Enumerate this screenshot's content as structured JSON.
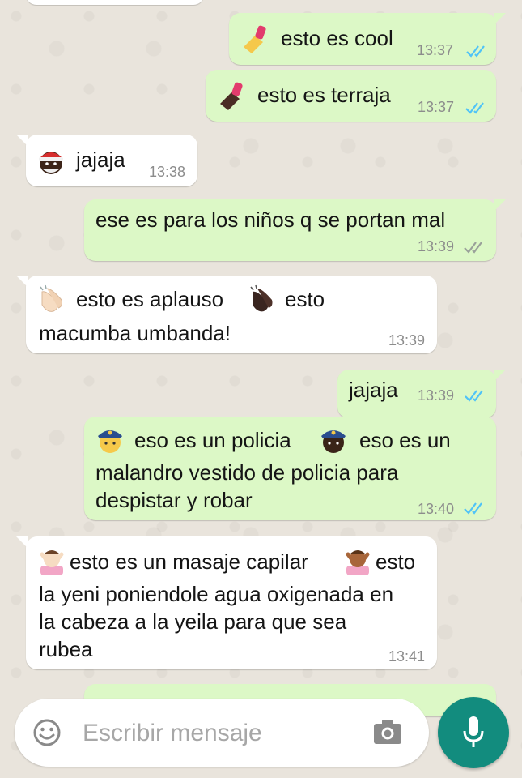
{
  "messages": [
    {
      "direction": "outgoing",
      "emojis": [
        "nail-polish-light"
      ],
      "text": "esto es cool",
      "time": "13:37",
      "status": "read"
    },
    {
      "direction": "outgoing",
      "emojis": [
        "nail-polish-dark"
      ],
      "text": "esto es terraja",
      "time": "13:37",
      "status": "read"
    },
    {
      "direction": "incoming",
      "emojis": [
        "santa-dark"
      ],
      "text": "jajaja",
      "time": "13:38"
    },
    {
      "direction": "outgoing",
      "text": "ese es para los niños q se portan mal",
      "time": "13:39",
      "status": "delivered"
    },
    {
      "direction": "incoming",
      "emojis": [
        "clapping-hands-light",
        "clapping-hands-dark"
      ],
      "text_a": "esto es aplauso",
      "text_b": "esto",
      "text_c": "macumba umbanda!",
      "time": "13:39"
    },
    {
      "direction": "outgoing",
      "text": "jajaja",
      "time": "13:39",
      "status": "read"
    },
    {
      "direction": "outgoing",
      "emojis": [
        "police-officer-light",
        "police-officer-dark"
      ],
      "text_a": "eso es un policia",
      "text_b": "eso es un",
      "text_c": "malandro vestido de policia para\ndespistar y robar",
      "time": "13:40",
      "status": "read"
    },
    {
      "direction": "incoming",
      "emojis": [
        "haircut-light",
        "haircut-dark"
      ],
      "text_a": "esto es un masaje capilar",
      "text_b": "esto",
      "text_c": "la yeni poniendole agua oxigenada en\nla cabeza a la yeila para que sea\nrubea",
      "time": "13:41"
    }
  ],
  "composer": {
    "placeholder": "Escribir mensaje",
    "emoji_icon": "smiley-icon",
    "camera_icon": "camera-icon",
    "mic_icon": "microphone-icon"
  },
  "colors": {
    "outgoing_bubble": "#dcf8c6",
    "incoming_bubble": "#ffffff",
    "read_ticks": "#4fc3f7",
    "mic_button": "#128c7e"
  }
}
